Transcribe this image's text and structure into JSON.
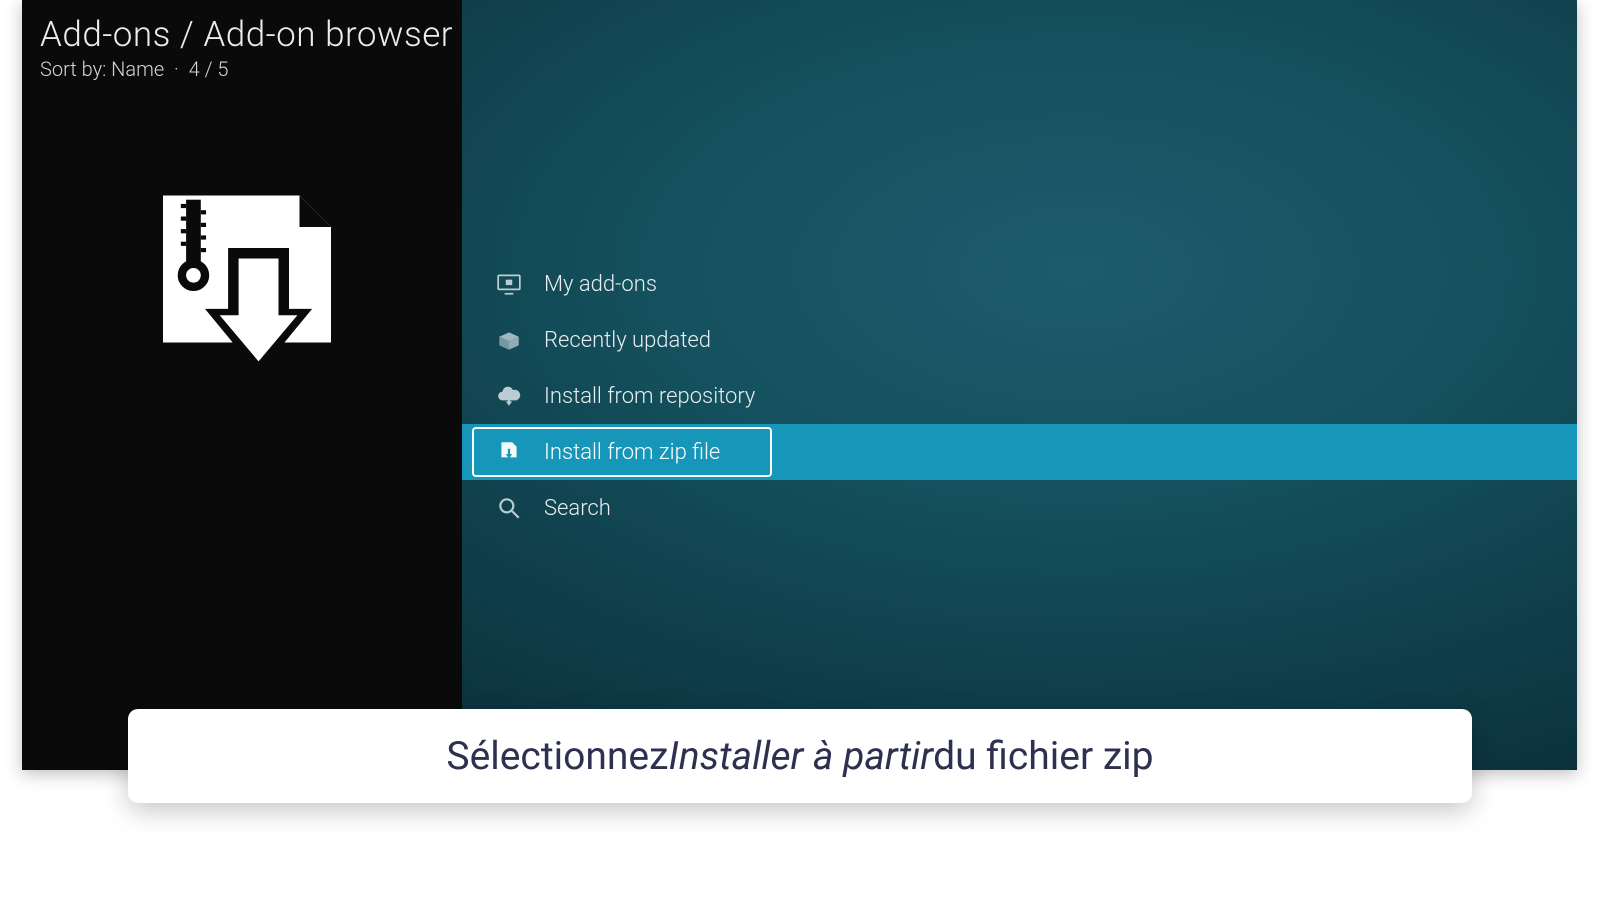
{
  "header": {
    "breadcrumb": "Add-ons / Add-on browser",
    "sort_label": "Sort by: Name",
    "position": "4 / 5"
  },
  "menu": {
    "items": [
      {
        "id": "my-addons",
        "label": "My add-ons",
        "icon": "monitor-box-icon",
        "selected": false
      },
      {
        "id": "recently-updated",
        "label": "Recently updated",
        "icon": "open-box-icon",
        "selected": false
      },
      {
        "id": "install-from-repository",
        "label": "Install from repository",
        "icon": "cloud-download-icon",
        "selected": false
      },
      {
        "id": "install-from-zip",
        "label": "Install from zip file",
        "icon": "zip-download-icon",
        "selected": true
      },
      {
        "id": "search",
        "label": "Search",
        "icon": "search-icon",
        "selected": false
      }
    ]
  },
  "sidebar": {
    "icon": "addon-download-icon"
  },
  "caption": {
    "prefix": "Sélectionnez ",
    "italic": "Installer à partir",
    "suffix": " du fichier zip"
  }
}
